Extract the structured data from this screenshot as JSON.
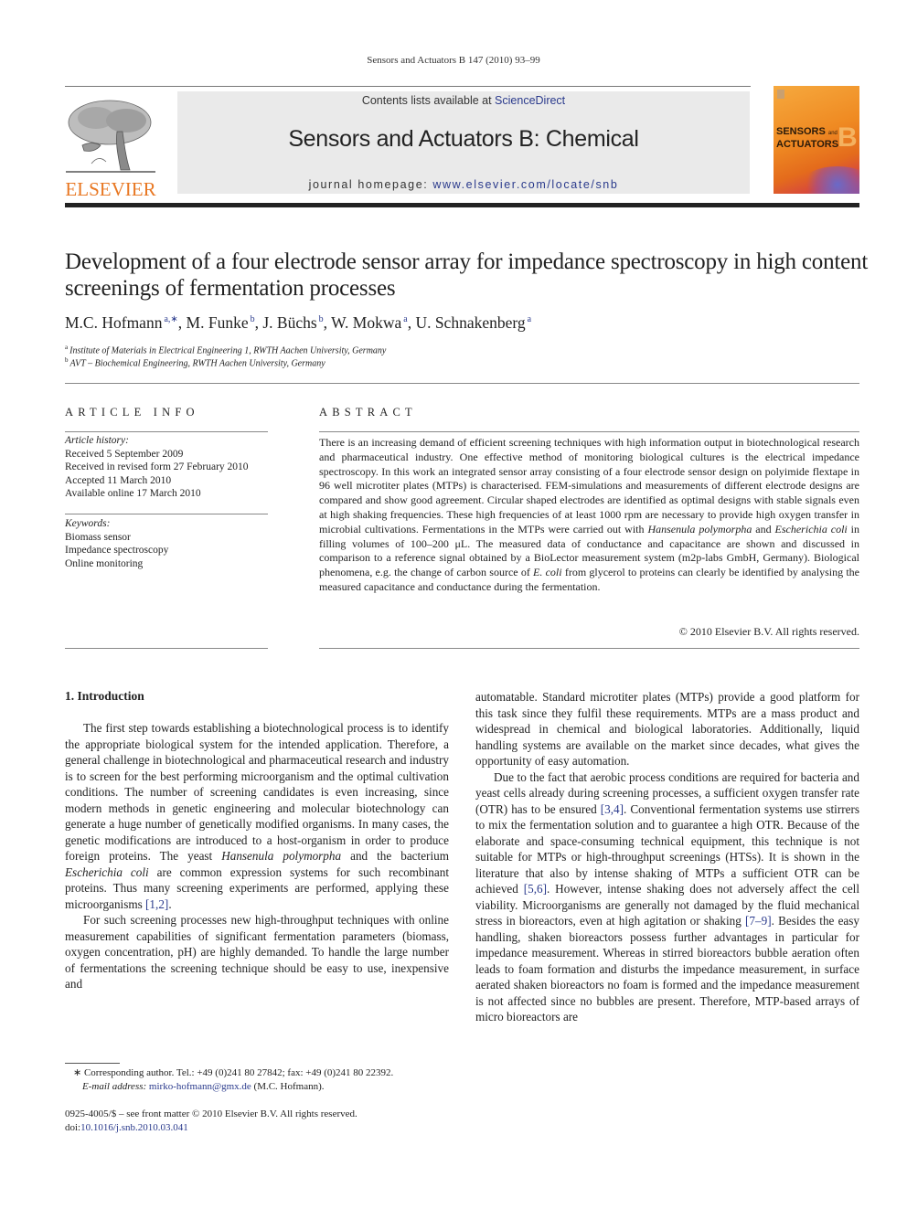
{
  "running_head": "Sensors and Actuators B 147 (2010) 93–99",
  "publisher": {
    "wordmark": "ELSEVIER",
    "logo_icon": "elsevier-tree-icon",
    "brand_color": "#e87722"
  },
  "masthead": {
    "contents_prefix": "Contents lists available at ",
    "contents_link": "ScienceDirect",
    "journal_title": "Sensors and Actuators B: Chemical",
    "homepage_prefix": "journal homepage: ",
    "homepage_link": "www.elsevier.com/locate/snb",
    "background": "#eaeaea",
    "link_color": "#2a3a8c"
  },
  "cover": {
    "line1": "SENSORS",
    "line1_small": "and",
    "line2": "ACTUATORS",
    "letter": "B"
  },
  "article": {
    "title": "Development of a four electrode sensor array for impedance spectroscopy in high content screenings of fermentation processes",
    "authors": [
      {
        "name": "M.C. Hofmann",
        "sup": "a,∗",
        "sep": ", "
      },
      {
        "name": "M. Funke",
        "sup": "b",
        "sep": ", "
      },
      {
        "name": "J. Büchs",
        "sup": "b",
        "sep": ", "
      },
      {
        "name": "W. Mokwa",
        "sup": "a",
        "sep": ", "
      },
      {
        "name": "U. Schnakenberg",
        "sup": "a",
        "sep": ""
      }
    ],
    "affiliations": [
      {
        "sup": "a",
        "text": "Institute of Materials in Electrical Engineering 1, RWTH Aachen University, Germany"
      },
      {
        "sup": "b",
        "text": "AVT – Biochemical Engineering, RWTH Aachen University, Germany"
      }
    ]
  },
  "article_info": {
    "heading": "ARTICLE INFO",
    "history_label": "Article history:",
    "history": [
      "Received 5 September 2009",
      "Received in revised form 27 February 2010",
      "Accepted 11 March 2010",
      "Available online 17 March 2010"
    ],
    "keywords_label": "Keywords:",
    "keywords": [
      "Biomass sensor",
      "Impedance spectroscopy",
      "Online monitoring"
    ]
  },
  "abstract": {
    "heading": "ABSTRACT",
    "p1": "There is an increasing demand of efficient screening techniques with high information output in biotechnological research and pharmaceutical industry. One effective method of monitoring biological cultures is the electrical impedance spectroscopy. In this work an integrated sensor array consisting of a four electrode sensor design on polyimide flextape in 96 well microtiter plates (MTPs) is characterised. FEM-simulations and measurements of different electrode designs are compared and show good agreement. Circular shaped electrodes are identified as optimal designs with stable signals even at high shaking frequencies. These high frequencies of at least 1000 rpm are necessary to provide high oxygen transfer in microbial cultivations. Fermentations in the MTPs were carried out with ",
    "it1": "Hansenula polymorpha",
    "p2": " and ",
    "it2": "Escherichia coli",
    "p3": " in filling volumes of 100–200 μL. The measured data of conductance and capacitance are shown and discussed in comparison to a reference signal obtained by a BioLector measurement system (m2p-labs GmbH, Germany). Biological phenomena, e.g. the change of carbon source of ",
    "it3": "E. coli",
    "p4": " from glycerol to proteins can clearly be identified by analysing the measured capacitance and conductance during the fermentation.",
    "copyright": "© 2010 Elsevier B.V. All rights reserved."
  },
  "body": {
    "section1_heading": "1.  Introduction",
    "col1_p1": "The first step towards establishing a biotechnological process is to identify the appropriate biological system for the intended application. Therefore, a general challenge in biotechnological and pharmaceutical research and industry is to screen for the best performing microorganism and the optimal cultivation conditions. The number of screening candidates is even increasing, since modern methods in genetic engineering and molecular biotechnology can generate a huge number of genetically modified organisms. In many cases, the genetic modifications are introduced to a host-organism in order to produce foreign proteins. The yeast ",
    "col1_p1_it1": "Hansenula polymorpha",
    "col1_p1_b": " and the bacterium ",
    "col1_p1_it2": "Escherichia coli",
    "col1_p1_c": " are common expression systems for such recombinant proteins. Thus many screening experiments are performed, applying these microorganisms ",
    "col1_p1_ref": "[1,2]",
    "col1_p1_end": ".",
    "col1_p2": "For such screening processes new high-throughput techniques with online measurement capabilities of significant fermentation parameters (biomass, oxygen concentration, pH) are highly demanded. To handle the large number of fermentations the screening technique should be easy to use, inexpensive and",
    "col2_p0": "automatable. Standard microtiter plates (MTPs) provide a good platform for this task since they fulfil these requirements. MTPs are a mass product and widespread in chemical and biological laboratories. Additionally, liquid handling systems are available on the market since decades, what gives the opportunity of easy automation.",
    "col2_p1_a": "Due to the fact that aerobic process conditions are required for bacteria and yeast cells already during screening processes, a sufficient oxygen transfer rate (OTR) has to be ensured ",
    "col2_p1_ref1": "[3,4]",
    "col2_p1_b": ". Conventional fermentation systems use stirrers to mix the fermentation solution and to guarantee a high OTR. Because of the elaborate and space-consuming technical equipment, this technique is not suitable for MTPs or high-throughput screenings (HTSs). It is shown in the literature that also by intense shaking of MTPs a sufficient OTR can be achieved ",
    "col2_p1_ref2": "[5,6]",
    "col2_p1_c": ". However, intense shaking does not adversely affect the cell viability. Microorganisms are generally not damaged by the fluid mechanical stress in bioreactors, even at high agitation or shaking ",
    "col2_p1_ref3": "[7–9]",
    "col2_p1_d": ". Besides the easy handling, shaken bioreactors possess further advantages in particular for impedance measurement. Whereas in stirred bioreactors bubble aeration often leads to foam formation and disturbs the impedance measurement, in surface aerated shaken bioreactors no foam is formed and the impedance measurement is not affected since no bubbles are present. Therefore, MTP-based arrays of micro bioreactors are"
  },
  "footnote": {
    "marker": "∗",
    "text": "Corresponding author. Tel.: +49 (0)241 80 27842; fax: +49 (0)241 80 22392.",
    "email_label": "E-mail address:",
    "email": "mirko-hofmann@gmx.de",
    "email_suffix": " (M.C. Hofmann)."
  },
  "front_matter": {
    "issn_line": "0925-4005/$ – see front matter © 2010 Elsevier B.V. All rights reserved.",
    "doi_prefix": "doi:",
    "doi": "10.1016/j.snb.2010.03.041"
  }
}
